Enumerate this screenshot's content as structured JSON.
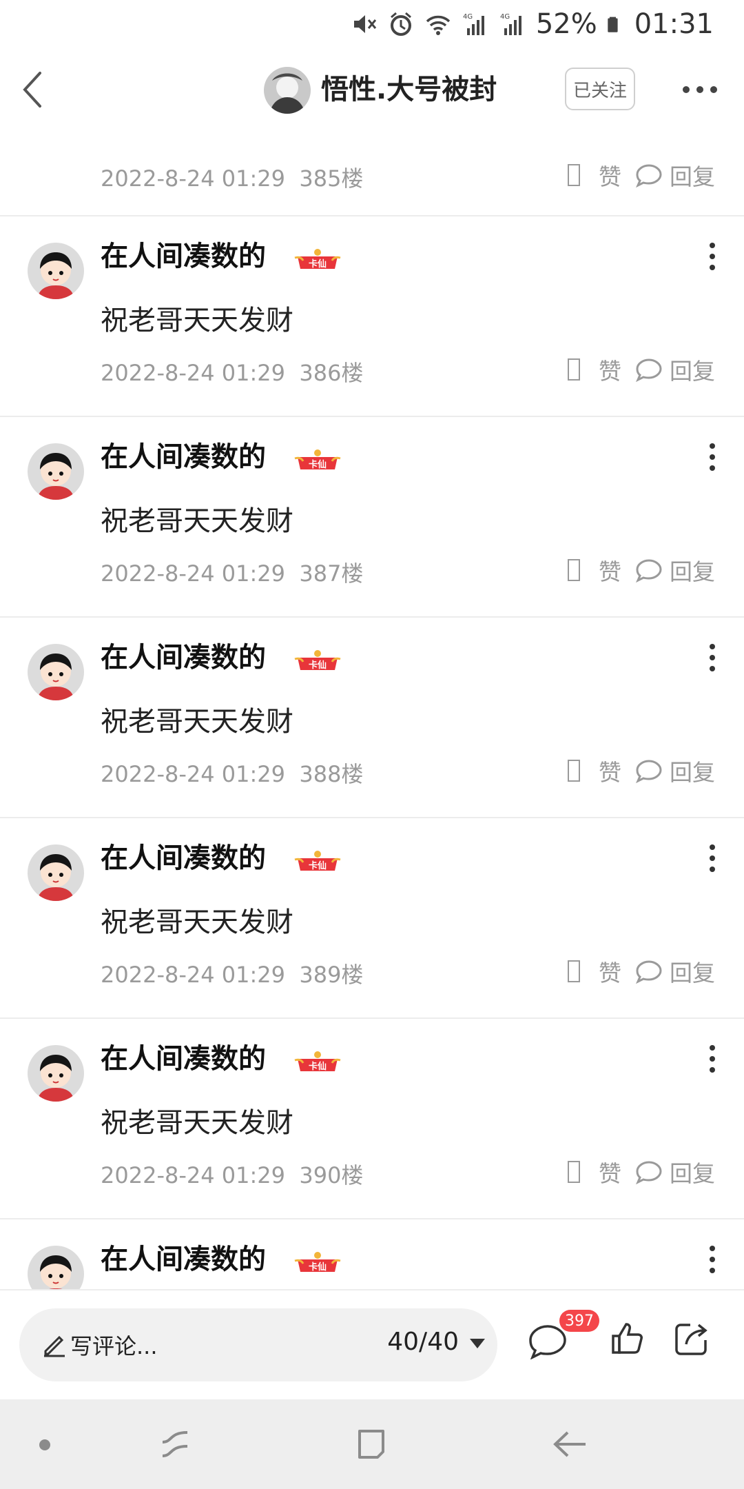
{
  "status_bar": {
    "battery": "52%",
    "time": "01:31"
  },
  "header": {
    "title": "悟性.大号被封",
    "follow_label": "已关注"
  },
  "top_meta": {
    "time": "2022-8-24 01:29",
    "floor": "385楼"
  },
  "actions": {
    "like_label": "赞",
    "reply_label": "回复"
  },
  "comments": [
    {
      "name": "在人间凑数的",
      "badge": "卡仙",
      "text": "祝老哥天天发财",
      "time": "2022-8-24 01:29",
      "floor": "386楼"
    },
    {
      "name": "在人间凑数的",
      "badge": "卡仙",
      "text": "祝老哥天天发财",
      "time": "2022-8-24 01:29",
      "floor": "387楼"
    },
    {
      "name": "在人间凑数的",
      "badge": "卡仙",
      "text": "祝老哥天天发财",
      "time": "2022-8-24 01:29",
      "floor": "388楼"
    },
    {
      "name": "在人间凑数的",
      "badge": "卡仙",
      "text": "祝老哥天天发财",
      "time": "2022-8-24 01:29",
      "floor": "389楼"
    },
    {
      "name": "在人间凑数的",
      "badge": "卡仙",
      "text": "祝老哥天天发财",
      "time": "2022-8-24 01:29",
      "floor": "390楼"
    },
    {
      "name": "在人间凑数的",
      "badge": "卡仙",
      "text": "",
      "time": "",
      "floor": ""
    }
  ],
  "bottom_bar": {
    "input_placeholder": "写评论...",
    "page_indicator": "40/40",
    "comment_count": "397"
  },
  "colors": {
    "badge_red": "#e8353a",
    "count_badge": "#f4464a",
    "meta_gray": "#9a9a9a"
  }
}
